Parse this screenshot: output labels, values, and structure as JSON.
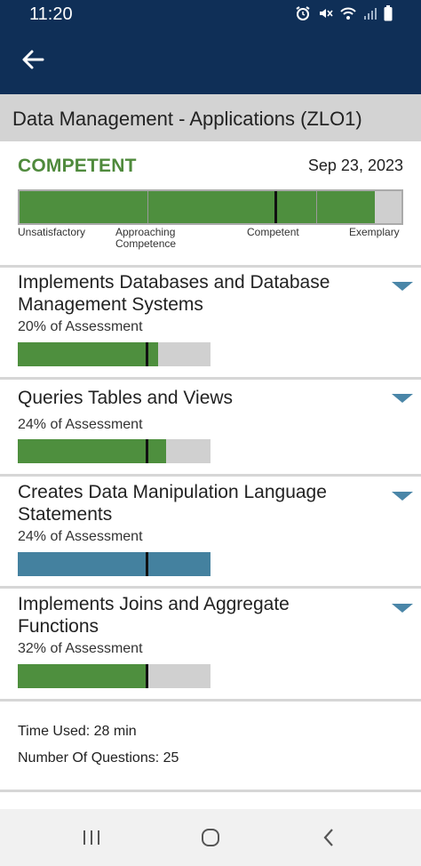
{
  "status_bar": {
    "time": "11:20"
  },
  "header": {
    "title": "Data Management - Applications (ZLO1)"
  },
  "overall": {
    "status": "COMPETENT",
    "date": "Sep 23, 2023",
    "score_fraction": 0.93,
    "scale_labels": [
      "Unsatisfactory",
      "Approaching Competence",
      "Competent",
      "Exemplary"
    ],
    "colors": {
      "status": "#4f8a3c",
      "fill": "#4e8f3e",
      "empty": "#cfcfcf"
    }
  },
  "sections": [
    {
      "title": "Implements Databases and Database Management Systems",
      "weight": "20% of Assessment",
      "score_fraction": 0.73,
      "color": "#4e8f3e"
    },
    {
      "title": "Queries Tables and Views",
      "weight": "24% of Assessment",
      "score_fraction": 0.77,
      "color": "#4e8f3e"
    },
    {
      "title": "Creates Data Manipulation Language Statements",
      "weight": "24% of Assessment",
      "score_fraction": 1.0,
      "color": "#44819f"
    },
    {
      "title": "Implements Joins and Aggregate Functions",
      "weight": "32% of Assessment",
      "score_fraction": 0.67,
      "color": "#4e8f3e"
    }
  ],
  "footer": {
    "time_used": "Time Used: 28 min",
    "number_of_questions": "Number Of Questions: 25"
  },
  "icons": {
    "back": "arrow-left-icon",
    "expand": "chevron-down-icon",
    "nav_recent": "recent-apps-icon",
    "nav_home": "home-icon",
    "nav_back": "nav-back-icon"
  }
}
